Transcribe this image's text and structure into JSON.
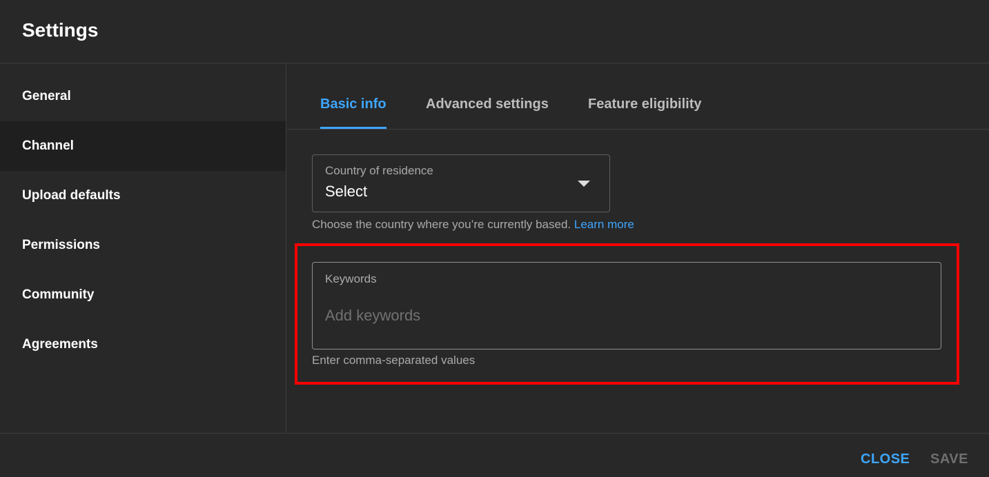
{
  "header": {
    "title": "Settings"
  },
  "sidebar": {
    "items": [
      {
        "label": "General"
      },
      {
        "label": "Channel",
        "active": true
      },
      {
        "label": "Upload defaults"
      },
      {
        "label": "Permissions"
      },
      {
        "label": "Community"
      },
      {
        "label": "Agreements"
      }
    ]
  },
  "tabs": [
    {
      "label": "Basic info",
      "active": true
    },
    {
      "label": "Advanced settings"
    },
    {
      "label": "Feature eligibility"
    }
  ],
  "country": {
    "label": "Country of residence",
    "value": "Select",
    "helper": "Choose the country where you’re currently based.",
    "link": "Learn more"
  },
  "keywords": {
    "label": "Keywords",
    "placeholder": "Add keywords",
    "value": "",
    "helper": "Enter comma-separated values"
  },
  "footer": {
    "close_label": "CLOSE",
    "save_label": "SAVE"
  },
  "colors": {
    "background": "#282828",
    "accent": "#3ea6ff",
    "highlight": "#ff0000",
    "active_nav": "#1f1f1f"
  }
}
